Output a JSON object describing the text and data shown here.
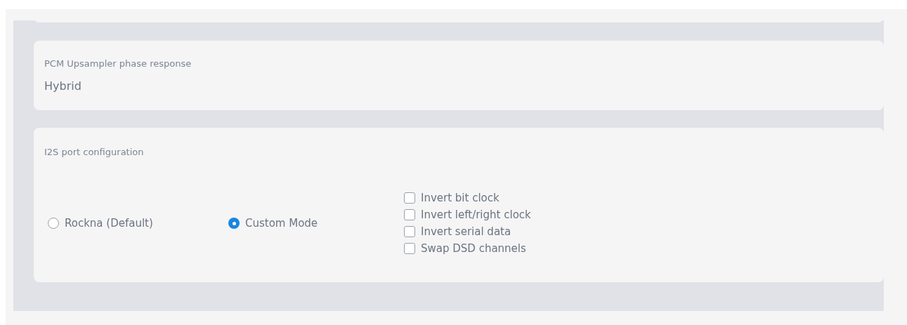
{
  "settings": [
    {
      "kind": "value",
      "label": "PCM Upsampler phase response",
      "value": "Hybrid"
    },
    {
      "kind": "options",
      "label": "I2S port configuration",
      "radios": [
        {
          "label": "Rockna (Default)",
          "selected": false
        },
        {
          "label": "Custom Mode",
          "selected": true
        }
      ],
      "checkboxes": [
        {
          "label": "Invert bit clock",
          "checked": false
        },
        {
          "label": "Invert left/right clock",
          "checked": false
        },
        {
          "label": "Invert serial data",
          "checked": false
        },
        {
          "label": "Swap DSD channels",
          "checked": false
        }
      ]
    }
  ]
}
